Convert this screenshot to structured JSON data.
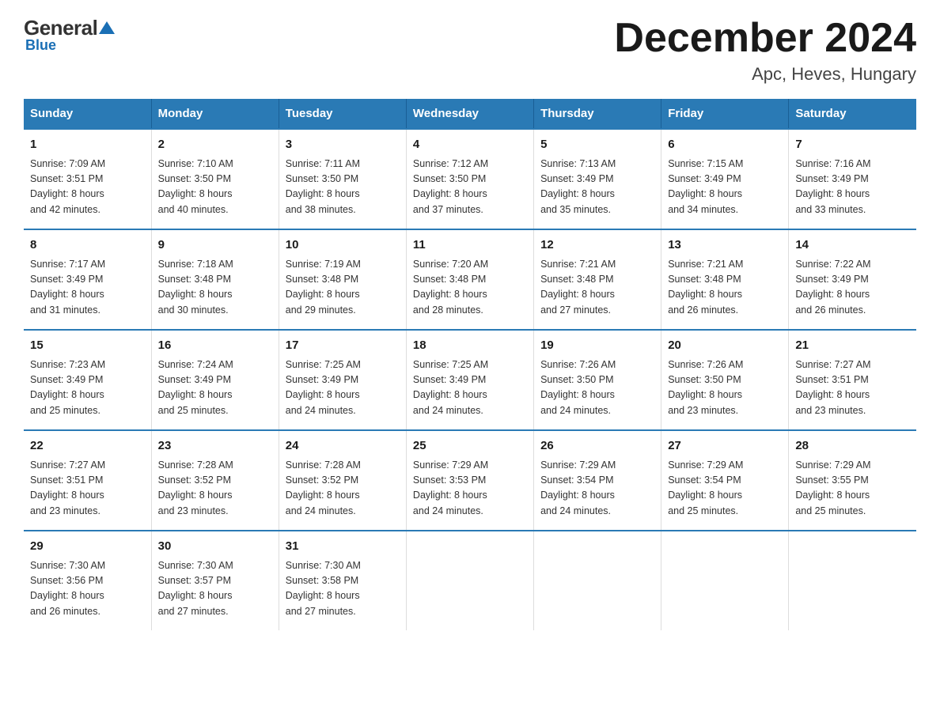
{
  "logo": {
    "general": "General",
    "blue": "Blue",
    "triangle": "▲"
  },
  "header": {
    "month_title": "December 2024",
    "location": "Apc, Heves, Hungary"
  },
  "days_of_week": [
    "Sunday",
    "Monday",
    "Tuesday",
    "Wednesday",
    "Thursday",
    "Friday",
    "Saturday"
  ],
  "weeks": [
    [
      {
        "day": "1",
        "sunrise": "7:09 AM",
        "sunset": "3:51 PM",
        "daylight": "8 hours and 42 minutes."
      },
      {
        "day": "2",
        "sunrise": "7:10 AM",
        "sunset": "3:50 PM",
        "daylight": "8 hours and 40 minutes."
      },
      {
        "day": "3",
        "sunrise": "7:11 AM",
        "sunset": "3:50 PM",
        "daylight": "8 hours and 38 minutes."
      },
      {
        "day": "4",
        "sunrise": "7:12 AM",
        "sunset": "3:50 PM",
        "daylight": "8 hours and 37 minutes."
      },
      {
        "day": "5",
        "sunrise": "7:13 AM",
        "sunset": "3:49 PM",
        "daylight": "8 hours and 35 minutes."
      },
      {
        "day": "6",
        "sunrise": "7:15 AM",
        "sunset": "3:49 PM",
        "daylight": "8 hours and 34 minutes."
      },
      {
        "day": "7",
        "sunrise": "7:16 AM",
        "sunset": "3:49 PM",
        "daylight": "8 hours and 33 minutes."
      }
    ],
    [
      {
        "day": "8",
        "sunrise": "7:17 AM",
        "sunset": "3:49 PM",
        "daylight": "8 hours and 31 minutes."
      },
      {
        "day": "9",
        "sunrise": "7:18 AM",
        "sunset": "3:48 PM",
        "daylight": "8 hours and 30 minutes."
      },
      {
        "day": "10",
        "sunrise": "7:19 AM",
        "sunset": "3:48 PM",
        "daylight": "8 hours and 29 minutes."
      },
      {
        "day": "11",
        "sunrise": "7:20 AM",
        "sunset": "3:48 PM",
        "daylight": "8 hours and 28 minutes."
      },
      {
        "day": "12",
        "sunrise": "7:21 AM",
        "sunset": "3:48 PM",
        "daylight": "8 hours and 27 minutes."
      },
      {
        "day": "13",
        "sunrise": "7:21 AM",
        "sunset": "3:48 PM",
        "daylight": "8 hours and 26 minutes."
      },
      {
        "day": "14",
        "sunrise": "7:22 AM",
        "sunset": "3:49 PM",
        "daylight": "8 hours and 26 minutes."
      }
    ],
    [
      {
        "day": "15",
        "sunrise": "7:23 AM",
        "sunset": "3:49 PM",
        "daylight": "8 hours and 25 minutes."
      },
      {
        "day": "16",
        "sunrise": "7:24 AM",
        "sunset": "3:49 PM",
        "daylight": "8 hours and 25 minutes."
      },
      {
        "day": "17",
        "sunrise": "7:25 AM",
        "sunset": "3:49 PM",
        "daylight": "8 hours and 24 minutes."
      },
      {
        "day": "18",
        "sunrise": "7:25 AM",
        "sunset": "3:49 PM",
        "daylight": "8 hours and 24 minutes."
      },
      {
        "day": "19",
        "sunrise": "7:26 AM",
        "sunset": "3:50 PM",
        "daylight": "8 hours and 24 minutes."
      },
      {
        "day": "20",
        "sunrise": "7:26 AM",
        "sunset": "3:50 PM",
        "daylight": "8 hours and 23 minutes."
      },
      {
        "day": "21",
        "sunrise": "7:27 AM",
        "sunset": "3:51 PM",
        "daylight": "8 hours and 23 minutes."
      }
    ],
    [
      {
        "day": "22",
        "sunrise": "7:27 AM",
        "sunset": "3:51 PM",
        "daylight": "8 hours and 23 minutes."
      },
      {
        "day": "23",
        "sunrise": "7:28 AM",
        "sunset": "3:52 PM",
        "daylight": "8 hours and 23 minutes."
      },
      {
        "day": "24",
        "sunrise": "7:28 AM",
        "sunset": "3:52 PM",
        "daylight": "8 hours and 24 minutes."
      },
      {
        "day": "25",
        "sunrise": "7:29 AM",
        "sunset": "3:53 PM",
        "daylight": "8 hours and 24 minutes."
      },
      {
        "day": "26",
        "sunrise": "7:29 AM",
        "sunset": "3:54 PM",
        "daylight": "8 hours and 24 minutes."
      },
      {
        "day": "27",
        "sunrise": "7:29 AM",
        "sunset": "3:54 PM",
        "daylight": "8 hours and 25 minutes."
      },
      {
        "day": "28",
        "sunrise": "7:29 AM",
        "sunset": "3:55 PM",
        "daylight": "8 hours and 25 minutes."
      }
    ],
    [
      {
        "day": "29",
        "sunrise": "7:30 AM",
        "sunset": "3:56 PM",
        "daylight": "8 hours and 26 minutes."
      },
      {
        "day": "30",
        "sunrise": "7:30 AM",
        "sunset": "3:57 PM",
        "daylight": "8 hours and 27 minutes."
      },
      {
        "day": "31",
        "sunrise": "7:30 AM",
        "sunset": "3:58 PM",
        "daylight": "8 hours and 27 minutes."
      },
      null,
      null,
      null,
      null
    ]
  ],
  "labels": {
    "sunrise": "Sunrise:",
    "sunset": "Sunset:",
    "daylight": "Daylight:"
  }
}
